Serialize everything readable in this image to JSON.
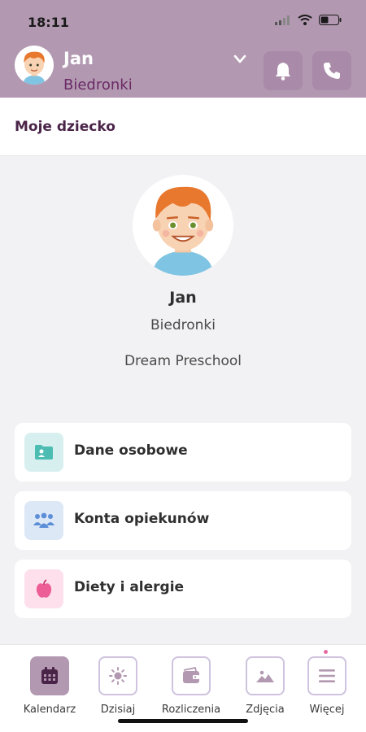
{
  "status_bar": {
    "time": "18:11"
  },
  "header": {
    "child_name": "Jan",
    "child_group": "Biedronki",
    "accent_color": "#b299b1"
  },
  "page": {
    "title": "Moje dziecko"
  },
  "profile": {
    "name": "Jan",
    "group": "Biedronki",
    "school": "Dream Preschool"
  },
  "menu": [
    {
      "label": "Dane osobowe",
      "icon": "personal-folder-icon",
      "color": "#d7f0ef"
    },
    {
      "label": "Konta opiekunów",
      "icon": "guardians-icon",
      "color": "#dde8f7"
    },
    {
      "label": "Diety i alergie",
      "icon": "apple-icon",
      "color": "#fde0ec"
    }
  ],
  "bottom_nav": [
    {
      "label": "Kalendarz",
      "icon": "calendar-icon",
      "active": true
    },
    {
      "label": "Dzisiaj",
      "icon": "sun-icon",
      "active": false
    },
    {
      "label": "Rozliczenia",
      "icon": "wallet-icon",
      "active": false
    },
    {
      "label": "Zdjęcia",
      "icon": "photo-icon",
      "active": false
    },
    {
      "label": "Więcej",
      "icon": "menu-icon",
      "active": false
    }
  ]
}
